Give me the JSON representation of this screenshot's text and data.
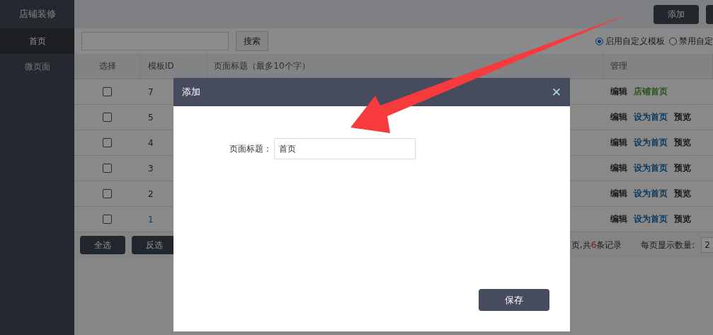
{
  "sidebar": {
    "title": "店铺装修",
    "items": [
      {
        "label": "首页",
        "selected": true
      },
      {
        "label": "微页面",
        "selected": false
      }
    ]
  },
  "top_bar": {
    "buttons": [
      "添加"
    ]
  },
  "toolbar": {
    "search_button": "搜索",
    "radios": [
      {
        "label": "启用自定义模板",
        "selected": true
      },
      {
        "label": "禁用自定",
        "selected": false
      }
    ]
  },
  "table": {
    "columns": [
      "选择",
      "模板ID",
      "页面标题（最多10个字）",
      "管理"
    ],
    "rows": [
      {
        "checked": false,
        "id": "7",
        "id_link": false,
        "actions": [
          {
            "label": "编辑",
            "kind": "plain"
          },
          {
            "label": "店铺首页",
            "kind": "current"
          }
        ]
      },
      {
        "checked": false,
        "id": "5",
        "id_link": false,
        "actions": [
          {
            "label": "编辑",
            "kind": "plain"
          },
          {
            "label": "设为首页",
            "kind": "link"
          },
          {
            "label": "预览",
            "kind": "plain"
          }
        ]
      },
      {
        "checked": false,
        "id": "4",
        "id_link": false,
        "actions": [
          {
            "label": "编辑",
            "kind": "plain"
          },
          {
            "label": "设为首页",
            "kind": "link"
          },
          {
            "label": "预览",
            "kind": "plain"
          }
        ]
      },
      {
        "checked": false,
        "id": "3",
        "id_link": false,
        "actions": [
          {
            "label": "编辑",
            "kind": "plain"
          },
          {
            "label": "设为首页",
            "kind": "link"
          },
          {
            "label": "预览",
            "kind": "plain"
          }
        ]
      },
      {
        "checked": false,
        "id": "2",
        "id_link": false,
        "actions": [
          {
            "label": "编辑",
            "kind": "plain"
          },
          {
            "label": "设为首页",
            "kind": "link"
          },
          {
            "label": "预览",
            "kind": "plain"
          }
        ]
      },
      {
        "checked": false,
        "id": "1",
        "id_link": true,
        "actions": [
          {
            "label": "编辑",
            "kind": "plain"
          },
          {
            "label": "设为首页",
            "kind": "link"
          },
          {
            "label": "预览",
            "kind": "plain"
          }
        ]
      }
    ]
  },
  "footer": {
    "buttons": [
      "全选",
      "反选"
    ],
    "records_prefix": "页,共",
    "records_count": "6",
    "records_suffix": "条记录",
    "page_size_label": "每页显示数量:",
    "page_size": "2"
  },
  "dialog": {
    "title": "添加",
    "close": "✕",
    "field_label": "页面标题：",
    "field_value": "首页",
    "save_button": "保存"
  }
}
